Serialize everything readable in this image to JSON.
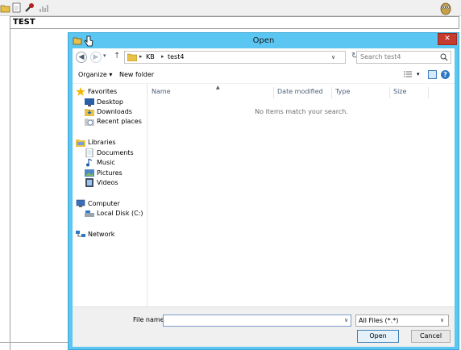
{
  "app": {
    "toolbar_icons": [
      "open-icon",
      "new-icon",
      "tools-icon",
      "chart-icon"
    ],
    "mascot_icon": "owl-icon",
    "test_label": "TEST"
  },
  "dialog": {
    "title": "Open",
    "close_label": "✕",
    "nav": {
      "back": "◀",
      "forward": "▶",
      "recent": "▾",
      "up": "↑"
    },
    "address": {
      "segments": [
        "KB",
        "test4"
      ],
      "separator": "▸",
      "dropdown": "∨",
      "refresh": "↻"
    },
    "search": {
      "placeholder": "Search test4"
    },
    "toolbar": {
      "organize_label": "Organize ▾",
      "new_folder_label": "New folder",
      "view_dropdown": "▾",
      "help_label": "?"
    },
    "nav_pane": {
      "favorites": "Favorites",
      "desktop": "Desktop",
      "downloads": "Downloads",
      "recent_places": "Recent places",
      "libraries": "Libraries",
      "documents": "Documents",
      "music": "Music",
      "pictures": "Pictures",
      "videos": "Videos",
      "computer": "Computer",
      "local_disk": "Local Disk (C:)",
      "network": "Network"
    },
    "columns": {
      "sort_indicator": "▲",
      "name": "Name",
      "date_modified": "Date modified",
      "type": "Type",
      "size": "Size"
    },
    "empty_message": "No items match your search.",
    "file_name_label": "File name:",
    "file_name_value": "",
    "file_name_dropdown": "∨",
    "filter_value": "All Files (*.*)",
    "filter_dropdown": "∨",
    "open_button": "Open",
    "cancel_button": "Cancel"
  },
  "colors": {
    "dialog_frame": "#5cc6f2",
    "close_button": "#c73a2e",
    "folder_yellow": "#e8c14a",
    "header_text": "#4c607a"
  }
}
